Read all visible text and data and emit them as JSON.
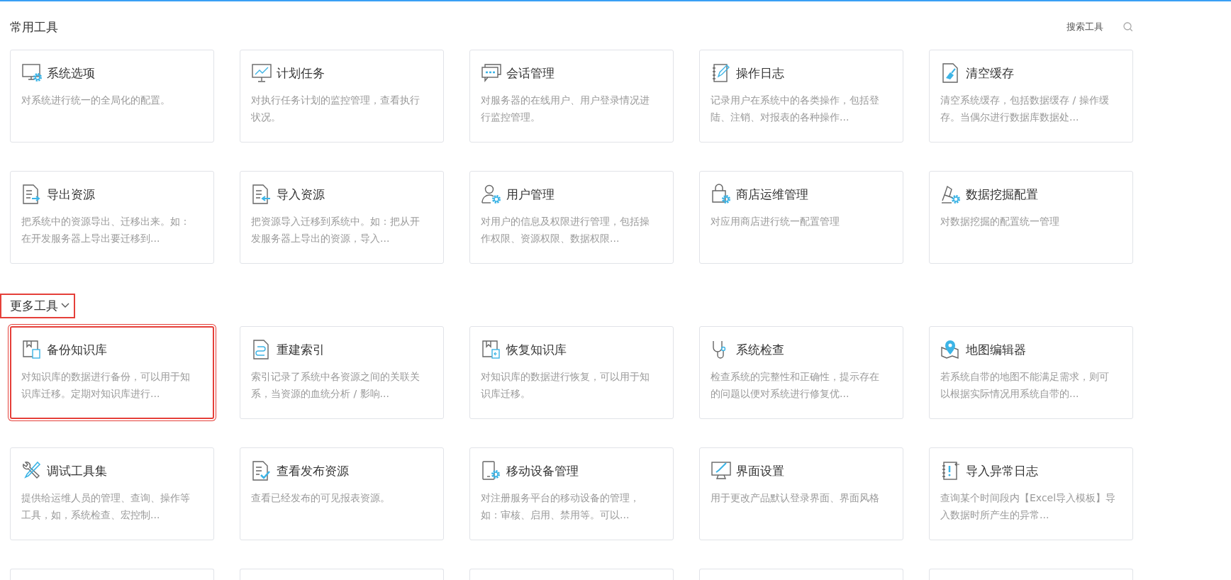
{
  "sections": [
    {
      "title": "常用工具",
      "collapsible": false,
      "highlighted": false,
      "search": {
        "label": "搜索工具"
      },
      "cards": [
        {
          "kind": "tool",
          "title": "系统选项",
          "description": "对系统进行统一的全局化的配置。",
          "highlighted": false
        },
        {
          "kind": "tool",
          "title": "计划任务",
          "description": "对执行任务计划的监控管理，查看执行状况。",
          "highlighted": false
        },
        {
          "kind": "tool",
          "title": "会话管理",
          "description": "对服务器的在线用户、用户登录情况进行监控管理。",
          "highlighted": false
        },
        {
          "kind": "tool",
          "title": "操作日志",
          "description": "记录用户在系统中的各类操作，包括登陆、注销、对报表的各种操作...",
          "highlighted": false
        },
        {
          "kind": "tool",
          "title": "清空缓存",
          "description": "清空系统缓存，包括数据缓存 / 操作缓存。当偶尔进行数据库数据处...",
          "highlighted": false
        },
        {
          "kind": "tool",
          "title": "导出资源",
          "description": "把系统中的资源导出、迁移出来。如：在开发服务器上导出要迁移到...",
          "highlighted": false
        },
        {
          "kind": "tool",
          "title": "导入资源",
          "description": "把资源导入迁移到系统中。如：把从开发服务器上导出的资源，导入...",
          "highlighted": false
        },
        {
          "kind": "tool",
          "title": "用户管理",
          "description": "对用户的信息及权限进行管理，包括操作权限、资源权限、数据权限...",
          "highlighted": false
        },
        {
          "kind": "tool",
          "title": "商店运维管理",
          "description": "对应用商店进行统一配置管理",
          "highlighted": false
        },
        {
          "kind": "tool",
          "title": "数据挖掘配置",
          "description": "对数据挖掘的配置统一管理",
          "highlighted": false
        }
      ]
    },
    {
      "title": "更多工具",
      "collapsible": true,
      "highlighted": true,
      "cards": [
        {
          "kind": "tool",
          "title": "备份知识库",
          "description": "对知识库的数据进行备份，可以用于知识库迁移。定期对知识库进行...",
          "highlighted": true
        },
        {
          "kind": "tool",
          "title": "重建索引",
          "description": "索引记录了系统中各资源之间的关联关系，当资源的血统分析 / 影响...",
          "highlighted": false
        },
        {
          "kind": "tool",
          "title": "恢复知识库",
          "description": "对知识库的数据进行恢复，可以用于知识库迁移。",
          "highlighted": false
        },
        {
          "kind": "tool",
          "title": "系统检查",
          "description": "检查系统的完整性和正确性，提示存在的问题以便对系统进行修复优...",
          "highlighted": false
        },
        {
          "kind": "tool",
          "title": "地图编辑器",
          "description": "若系统自带的地图不能满足需求，则可以根据实际情况用系统自带的...",
          "highlighted": false
        },
        {
          "kind": "tool",
          "title": "调试工具集",
          "description": "提供给运维人员的管理、查询、操作等工具，如，系统检查、宏控制...",
          "highlighted": false
        },
        {
          "kind": "tool",
          "title": "查看发布资源",
          "description": "查看已经发布的可见报表资源。",
          "highlighted": false
        },
        {
          "kind": "tool",
          "title": "移动设备管理",
          "description": "对注册服务平台的移动设备的管理，如：审核、启用、禁用等。可以...",
          "highlighted": false
        },
        {
          "kind": "tool",
          "title": "界面设置",
          "description": "用于更改产品默认登录界面、界面风格",
          "highlighted": false
        },
        {
          "kind": "tool",
          "title": "导入异常日志",
          "description": "查询某个时间段内【Excel导入模板】导入数据时所产生的异常...",
          "highlighted": false
        },
        {
          "kind": "cut"
        },
        {
          "kind": "cut"
        },
        {
          "kind": "cut"
        },
        {
          "kind": "cut"
        },
        {
          "kind": "cut"
        }
      ]
    }
  ]
}
